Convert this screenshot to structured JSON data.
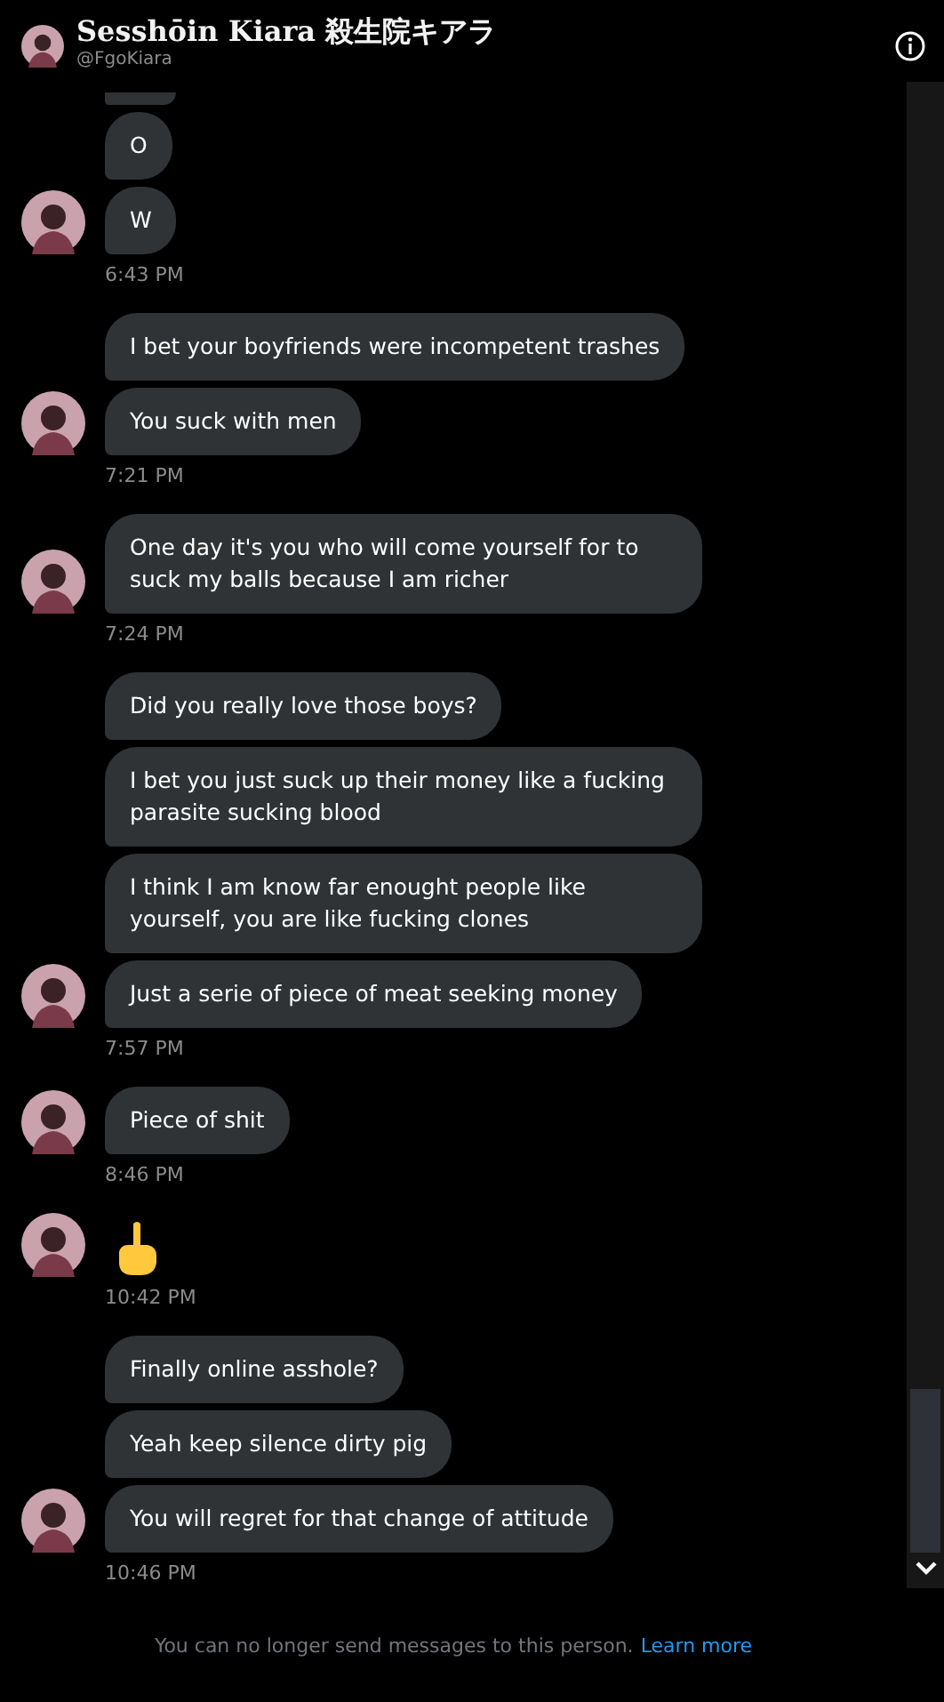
{
  "header": {
    "name": "Sesshōin Kiara 殺生院キアラ",
    "handle": "@FgoKiara"
  },
  "groups": [
    {
      "messages": [
        {
          "kind": "clipped"
        },
        {
          "kind": "text",
          "text": "O"
        },
        {
          "kind": "text",
          "text": "W"
        }
      ],
      "time": "6:43 PM"
    },
    {
      "messages": [
        {
          "kind": "text",
          "text": "I bet your boyfriends were incompetent trashes"
        },
        {
          "kind": "text",
          "text": "You suck with men"
        }
      ],
      "time": "7:21 PM"
    },
    {
      "messages": [
        {
          "kind": "text",
          "text": "One day it's you who will come yourself for to suck my balls because I am richer"
        }
      ],
      "time": "7:24 PM"
    },
    {
      "messages": [
        {
          "kind": "text",
          "text": "Did you really love those boys?"
        },
        {
          "kind": "text",
          "text": "I bet you just suck up their money like a fucking parasite sucking blood"
        },
        {
          "kind": "text",
          "text": "I think I am know far enought people like yourself, you are like fucking clones"
        },
        {
          "kind": "text",
          "text": "Just a serie of piece of meat seeking money"
        }
      ],
      "time": "7:57 PM"
    },
    {
      "messages": [
        {
          "kind": "text",
          "text": "Piece of shit"
        }
      ],
      "time": "8:46 PM"
    },
    {
      "messages": [
        {
          "kind": "emoji"
        }
      ],
      "time": "10:42 PM"
    },
    {
      "messages": [
        {
          "kind": "text",
          "text": "Finally online asshole?"
        },
        {
          "kind": "text",
          "text": "Yeah keep silence dirty pig"
        },
        {
          "kind": "text",
          "text": "You will regret for that change of attitude"
        }
      ],
      "time": "10:46 PM"
    }
  ],
  "notice": {
    "text": "You can no longer send messages to this person.",
    "link": "Learn more"
  }
}
